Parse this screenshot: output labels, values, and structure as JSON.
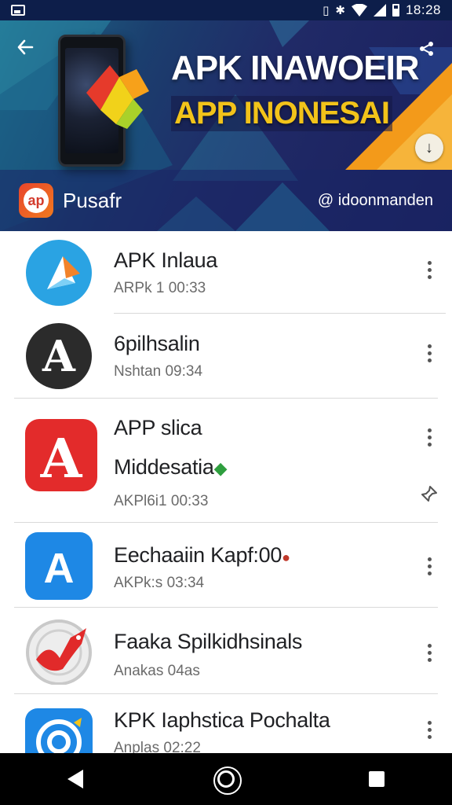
{
  "status_bar": {
    "time": "18:28",
    "icons": [
      "gallery-icon",
      "vibrate-icon",
      "bluetooth-icon",
      "wifi-icon",
      "signal-icon",
      "battery-icon"
    ]
  },
  "banner": {
    "title": "APK INAWOEIR",
    "subtitle": "APP INONESAI",
    "brand_logo_text": "ap",
    "brand_name": "Pusafr",
    "handle": "@ idoonmanden",
    "colors": {
      "title": "#ffffff",
      "subtitle": "#f2c31a",
      "background": "#1f2a63",
      "accent": "#f39a1a"
    }
  },
  "apps": [
    {
      "title": "APK Inlaua",
      "subtitle": "ARPk 1 00:33",
      "icon": "blue-play-icon"
    },
    {
      "title": "6pilhsalin",
      "subtitle": "Nshtan 09:34",
      "icon": "black-a-icon"
    },
    {
      "title": "APP slica",
      "title2": "Middesatia",
      "subtitle": "AKPl6i1 00:33",
      "icon": "red-a-icon"
    },
    {
      "title": "Eechaaiin Kapf:00",
      "subtitle": "AKPk:s 03:34",
      "icon": "blue-a-icon"
    },
    {
      "title": "Faaka Spilkidhsinals",
      "subtitle": "Anakas 04as",
      "icon": "red-dragon-icon"
    },
    {
      "title": "KPK Iaphstica Pochalta",
      "subtitle": "Anplas 02:22",
      "icon": "blue-target-icon"
    }
  ],
  "nav": {
    "icons": [
      "back-icon",
      "home-icon",
      "recent-apps-icon"
    ]
  }
}
